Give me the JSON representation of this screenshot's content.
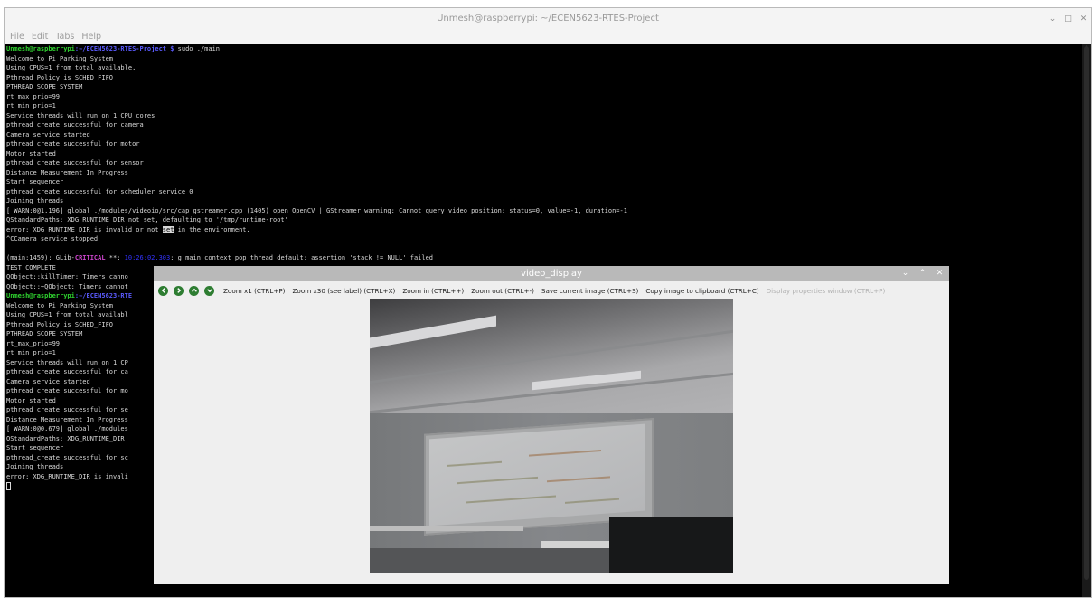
{
  "terminal": {
    "title": "Unmesh@raspberrypi: ~/ECEN5623-RTES-Project",
    "window_controls": [
      "⌄",
      "□",
      "✕"
    ],
    "menu": [
      "File",
      "Edit",
      "Tabs",
      "Help"
    ],
    "prompt_user": "Unmesh@raspberrypi",
    "prompt_path": ":~/ECEN5623-RTES-Project $",
    "command": " sudo ./main",
    "lines": [
      "Welcome to Pi Parking System",
      "Using CPUS=1 from total available.",
      "Pthread Policy is SCHED_FIFO",
      "PTHREAD SCOPE SYSTEM",
      "rt_max_prio=99",
      "rt_min_prio=1",
      "Service threads will run on 1 CPU cores",
      "pthread_create successful for camera",
      "Camera service started",
      "pthread_create successful for motor",
      "Motor started",
      "pthread_create successful for sensor",
      "Distance Measurement In Progress",
      "Start sequencer",
      "pthread_create successful for scheduler service 0",
      "Joining threads",
      "[ WARN:0@1.196] global ./modules/videoio/src/cap_gstreamer.cpp (1405) open OpenCV | GStreamer warning: Cannot query video position: status=0, value=-1, duration=-1",
      "QStandardPaths: XDG_RUNTIME_DIR not set, defaulting to '/tmp/runtime-root'"
    ],
    "error_line_pre": "error: XDG_RUNTIME_DIR is invalid or not ",
    "error_line_hl": "set",
    "error_line_post": " in the environment.",
    "camera_stopped": "^CCamera service stopped",
    "glib_pre": "(main:1459): GLib-",
    "glib_crit": "CRITICAL",
    "glib_mid": " **: ",
    "glib_hidden": "10:26:02.303",
    "glib_post": ": g_main_context_pop_thread_default: assertion 'stack != NULL' failed",
    "lines2": [
      "TEST COMPLETE",
      "QObject::killTimer: Timers canno",
      "QObject::~QObject: Timers cannot"
    ],
    "prompt2_path": ":~/ECEN5623-RTE",
    "lines3": [
      "Welcome to Pi Parking System",
      "Using CPUS=1 from total availabl",
      "Pthread Policy is SCHED_FIFO",
      "PTHREAD SCOPE SYSTEM",
      "rt_max_prio=99",
      "rt_min_prio=1",
      "Service threads will run on 1 CP",
      "pthread_create successful for ca",
      "Camera service started",
      "pthread_create successful for mo",
      "Motor started",
      "pthread_create successful for se",
      "Distance Measurement In Progress",
      "[ WARN:0@0.679] global ./modules",
      "QStandardPaths: XDG_RUNTIME_DIR ",
      "Start sequencer",
      "pthread_create successful for sc",
      "Joining threads",
      "error: XDG_RUNTIME_DIR is invali"
    ]
  },
  "video_window": {
    "title": "video_display",
    "window_controls": [
      "⌄",
      "⌃",
      "✕"
    ],
    "nav_buttons": [
      "left",
      "right",
      "up",
      "down"
    ],
    "toolbar": [
      {
        "label": "Zoom x1 (CTRL+P)",
        "enabled": true
      },
      {
        "label": "Zoom x30 (see label) (CTRL+X)",
        "enabled": true
      },
      {
        "label": "Zoom in (CTRL++)",
        "enabled": true
      },
      {
        "label": "Zoom out (CTRL+-)",
        "enabled": true
      },
      {
        "label": "Save current image (CTRL+S)",
        "enabled": true
      },
      {
        "label": "Copy image to clipboard (CTRL+C)",
        "enabled": true
      },
      {
        "label": "Display properties window (CTRL+P)",
        "enabled": false
      }
    ]
  },
  "colors": {
    "prompt_user": "#2fd12f",
    "prompt_path": "#5b5bff",
    "critical": "#d046d0",
    "nav_button": "#2e7d32"
  }
}
